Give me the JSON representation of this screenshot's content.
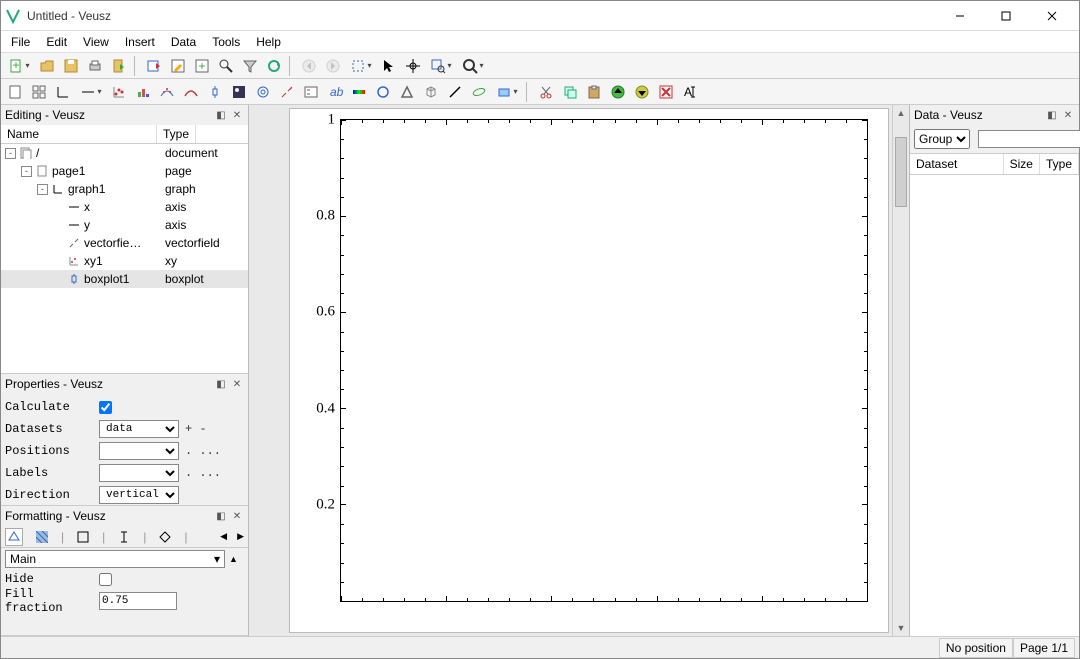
{
  "window": {
    "title": "Untitled - Veusz"
  },
  "menu": [
    "File",
    "Edit",
    "View",
    "Insert",
    "Data",
    "Tools",
    "Help"
  ],
  "panels": {
    "editing_title": "Editing - Veusz",
    "properties_title": "Properties - Veusz",
    "formatting_title": "Formatting - Veusz",
    "data_title": "Data - Veusz"
  },
  "tree": {
    "headers": {
      "name": "Name",
      "type": "Type"
    },
    "rows": [
      {
        "indent": 0,
        "toggle": "-",
        "icon": "doc",
        "name": "/",
        "type": "document"
      },
      {
        "indent": 1,
        "toggle": "-",
        "icon": "page",
        "name": "page1",
        "type": "page"
      },
      {
        "indent": 2,
        "toggle": "-",
        "icon": "graph",
        "name": "graph1",
        "type": "graph"
      },
      {
        "indent": 3,
        "toggle": "",
        "icon": "axis",
        "name": "x",
        "type": "axis"
      },
      {
        "indent": 3,
        "toggle": "",
        "icon": "axis",
        "name": "y",
        "type": "axis"
      },
      {
        "indent": 3,
        "toggle": "",
        "icon": "vec",
        "name": "vectorfie…",
        "type": "vectorfield"
      },
      {
        "indent": 3,
        "toggle": "",
        "icon": "xy",
        "name": "xy1",
        "type": "xy"
      },
      {
        "indent": 3,
        "toggle": "",
        "icon": "box",
        "name": "boxplot1",
        "type": "boxplot",
        "selected": true
      }
    ]
  },
  "properties": {
    "rows": [
      {
        "label": "Calculate",
        "kind": "check",
        "checked": true
      },
      {
        "label": "Datasets",
        "kind": "combo",
        "value": "data",
        "extra": "+  -"
      },
      {
        "label": "Positions",
        "kind": "combo",
        "value": "",
        "extra": ". ..."
      },
      {
        "label": "Labels",
        "kind": "combo",
        "value": "",
        "extra": ". ..."
      },
      {
        "label": "Direction",
        "kind": "combo",
        "value": "vertical"
      }
    ]
  },
  "formatting": {
    "main_combo": "Main",
    "rows": [
      {
        "label": "Hide",
        "kind": "check",
        "checked": false
      },
      {
        "label": "Fill fraction",
        "kind": "text",
        "value": "0.75"
      }
    ]
  },
  "data_panel": {
    "group_label": "Group",
    "headers": [
      "Dataset",
      "Size",
      "Type"
    ]
  },
  "status": {
    "pos": "No position",
    "page": "Page 1/1"
  },
  "chart_data": {
    "type": "line",
    "title": "",
    "xlabel": "",
    "ylabel": "",
    "xlim": [
      0,
      1
    ],
    "ylim": [
      0,
      1
    ],
    "yticks": [
      0.2,
      0.4,
      0.6,
      0.8,
      1
    ],
    "series": []
  }
}
